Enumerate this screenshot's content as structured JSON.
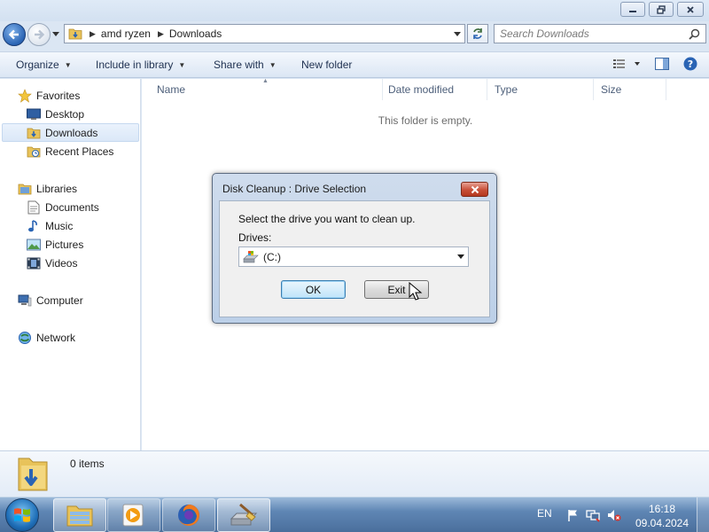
{
  "explorer": {
    "breadcrumb": [
      "amd ryzen",
      "Downloads"
    ],
    "search_placeholder": "Search Downloads",
    "commands": {
      "organize": "Organize",
      "include_in_library": "Include in library",
      "share_with": "Share with",
      "new_folder": "New folder"
    },
    "nav": {
      "favorites": "Favorites",
      "favorites_items": [
        "Desktop",
        "Downloads",
        "Recent Places"
      ],
      "libraries": "Libraries",
      "libraries_items": [
        "Documents",
        "Music",
        "Pictures",
        "Videos"
      ],
      "computer": "Computer",
      "network": "Network",
      "selected": "Downloads"
    },
    "columns": [
      "Name",
      "Date modified",
      "Type",
      "Size"
    ],
    "empty_message": "This folder is empty.",
    "details": "0 items"
  },
  "dialog": {
    "title": "Disk Cleanup : Drive Selection",
    "prompt": "Select the drive you want to clean up.",
    "drives_label": "Drives:",
    "selected_drive": "(C:)",
    "ok_label": "OK",
    "exit_label": "Exit"
  },
  "taskbar": {
    "language": "EN",
    "time": "16:18",
    "date": "09.04.2024",
    "pinned": [
      "windows-explorer",
      "media-player",
      "firefox",
      "disk-cleanup"
    ]
  },
  "colors": {
    "window_bg": "#dbe6f3",
    "accent_blue": "#2a64b4",
    "dialog_close": "#c84f38"
  }
}
